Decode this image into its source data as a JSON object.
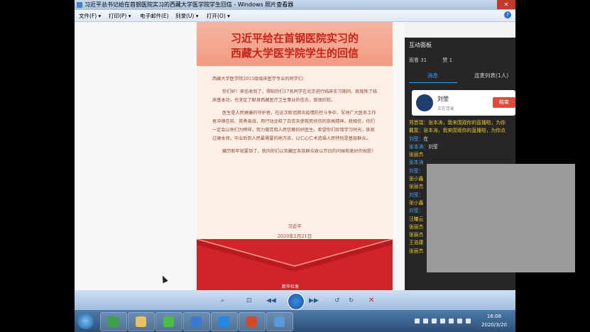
{
  "window": {
    "title": "习近平总书记给在首钢医院实习的西藏大学医学院学生回信 - Windows 照片查看器",
    "close_label": "✕"
  },
  "menu": {
    "items": [
      "文件(F) ▾",
      "打印(P) ▾",
      "电子邮件(E)",
      "刻录(U) ▾",
      "打开(O) ▾"
    ],
    "help": "?"
  },
  "letter": {
    "title_line1": "习近平给在首钢医院实习的",
    "title_line2": "西藏大学医学院学生的回信",
    "greeting": "西藏大学医学院2015级临床医学专业的同学们：",
    "paragraphs": [
      "你们好！来信收到了，得知你们17名同学在北京进行临床实习期间，既锻炼了临床基本功，也坚定了献身西藏医疗卫生事业的信念，我很欣慰。",
      "医生是人民健康的守护者。在这次新冠肺炎疫情防控斗争中，军地广大医务工作者冲锋在前、英勇奋战，用行动诠释了白衣天使救死扶伤的崇高精神。我相信，你们一定会以他们为榜样，努力做党和人民信赖的好医生。希望你们珍惜学习时光，练就过硬本领，毕业后到人民最需要的地方去，以仁心仁术造福人民特别是基层群众。",
      "藏历新年就要到了，我向你们以及藏区各族群众致以节日的问候和美好的祝愿！"
    ],
    "signature": "习近平",
    "date": "2020年2月21日",
    "footer_logo": "新华社发"
  },
  "panel": {
    "title": "互动面板",
    "views": "观看 31",
    "likes": "赞 1",
    "tab_messages": "消息",
    "tab_connect": "连麦列表(1人)",
    "card_name": "刘莹",
    "card_status": "正在连麦",
    "card_end": "结束",
    "messages": [
      {
        "name": "郑晋瑞：",
        "text": "张本涛，我来围观你的直播啦，为你",
        "name_blue": false,
        "text_white": false
      },
      {
        "name": "戴晁：",
        "text": "张本涛，我来围观你的直播啦，为你点",
        "name_blue": false,
        "text_white": false
      },
      {
        "name": "刘莹：",
        "text": "在",
        "name_blue": true,
        "text_white": true
      },
      {
        "name": "张本涛：",
        "text": "刘莹",
        "name_blue": true,
        "text_white": true
      },
      {
        "name": "张丽杰",
        "text": "",
        "name_blue": false,
        "text_white": false
      },
      {
        "name": "张本涛",
        "text": "",
        "name_blue": true,
        "text_white": false
      },
      {
        "name": "刘莹：",
        "text": "",
        "name_blue": true,
        "text_white": false
      },
      {
        "name": "张小鑫",
        "text": "",
        "name_blue": false,
        "text_white": false
      },
      {
        "name": "张丽杰",
        "text": "",
        "name_blue": false,
        "text_white": false
      },
      {
        "name": "刘莹：",
        "text": "",
        "name_blue": true,
        "text_white": false
      },
      {
        "name": "张小鑫",
        "text": "",
        "name_blue": false,
        "text_white": false
      },
      {
        "name": "刘莹：",
        "text": "",
        "name_blue": true,
        "text_white": false
      },
      {
        "name": "汪曦云",
        "text": "",
        "name_blue": false,
        "text_white": false
      },
      {
        "name": "张丽杰",
        "text": "",
        "name_blue": false,
        "text_white": false
      },
      {
        "name": "张丽杰",
        "text": "",
        "name_blue": false,
        "text_white": false
      },
      {
        "name": "王浩康",
        "text": "",
        "name_blue": false,
        "text_white": false
      },
      {
        "name": "张丽杰",
        "text": "",
        "name_blue": false,
        "text_white": false
      }
    ]
  },
  "viewer_controls": {
    "zoom": "⌕",
    "fit": "⊡",
    "prev": "◀◀",
    "next": "▶▶",
    "rotate_ccw": "↺",
    "rotate_cw": "↻",
    "delete": "✕"
  },
  "taskbar": {
    "time": "16:06",
    "date": "2020/3/20"
  },
  "colors": {
    "accent": "#c8231a",
    "panel_bg": "#262626",
    "envelope_red": "#d1242a"
  }
}
